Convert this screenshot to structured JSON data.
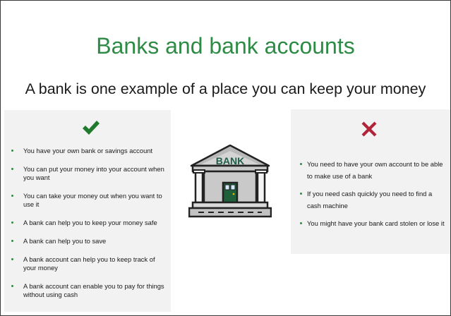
{
  "slide": {
    "title": "Banks and bank accounts",
    "subtitle": "A bank is one example of a place you can keep your money"
  },
  "pros": {
    "icon": "check-mark-icon",
    "items": [
      "You have your own bank or savings account",
      "You can put your money into your account when you want",
      "You can take your money out when you want to use it",
      "A bank can help you to keep your money safe",
      "A bank can help you to save",
      "A bank account can help you to keep track of your money",
      "A bank account can enable you to pay for things without using cash"
    ]
  },
  "cons": {
    "icon": "cross-mark-icon",
    "items": [
      "You need to have your own account to be able to make use of a bank",
      "If you need cash quickly you need to find a cash machine",
      "You might have your bank card stolen or lose it"
    ]
  },
  "bank_illustration": {
    "icon": "bank-building-icon",
    "sign": "BANK"
  },
  "colors": {
    "title": "#2e8b45",
    "check": "#1f7a2e",
    "cross": "#b0243a",
    "panel": "#f2f2f2",
    "bullet": "#2e8b45"
  }
}
